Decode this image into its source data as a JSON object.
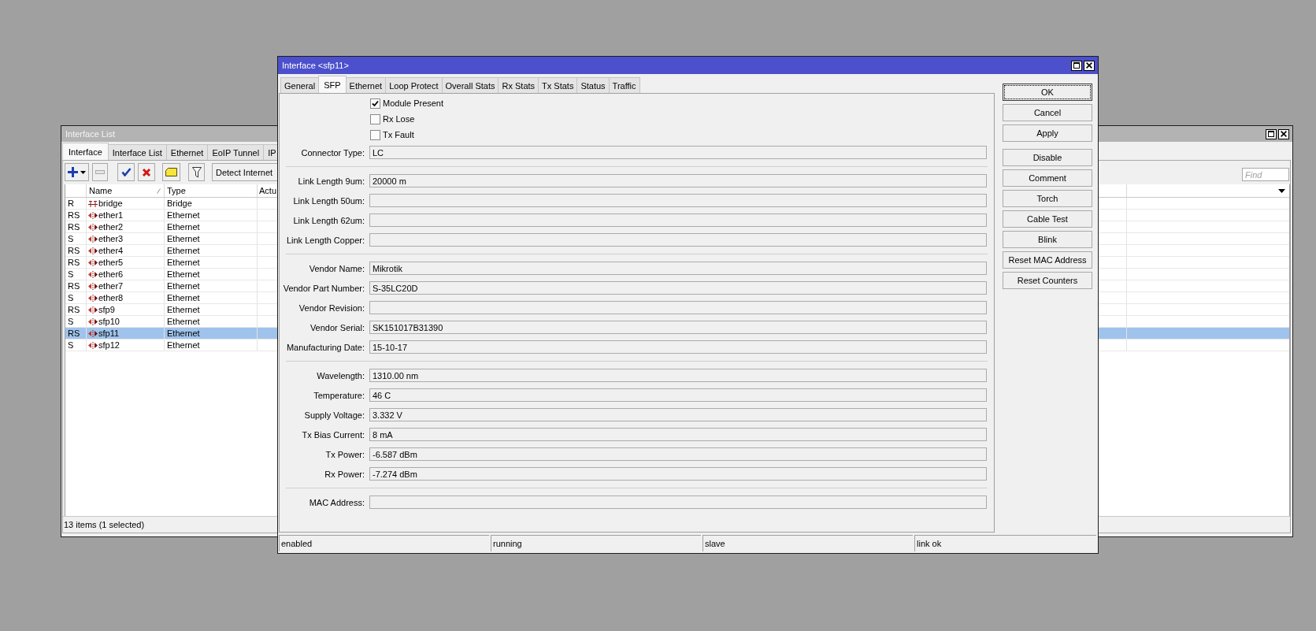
{
  "interface_list_window": {
    "title": "Interface List",
    "active": false,
    "tabs": [
      {
        "label": "Interface",
        "selected": true
      },
      {
        "label": "Interface List",
        "selected": false
      },
      {
        "label": "Ethernet",
        "selected": false
      },
      {
        "label": "EoIP Tunnel",
        "selected": false
      },
      {
        "label": "IP",
        "selected": false
      }
    ],
    "toolbar": [
      {
        "kind": "add",
        "disabled": false
      },
      {
        "kind": "remove",
        "disabled": true
      },
      {
        "kind": "enable",
        "disabled": false
      },
      {
        "kind": "disable",
        "disabled": false
      },
      {
        "kind": "comment",
        "disabled": false
      },
      {
        "kind": "filter",
        "disabled": false
      },
      {
        "kind": "text",
        "label": "Detect Internet",
        "disabled": false
      }
    ],
    "search": {
      "placeholder": "Find"
    },
    "table": {
      "columns": [
        {
          "label": "Name",
          "sorted": true
        },
        {
          "label": "Type",
          "sorted": false
        },
        {
          "label": "Actu",
          "sorted": false
        }
      ],
      "rows": [
        {
          "flags": "R",
          "kind": "bridge",
          "name": "bridge",
          "type": "Bridge",
          "selected": false
        },
        {
          "flags": "RS",
          "kind": "ethernet",
          "name": "ether1",
          "type": "Ethernet",
          "selected": false
        },
        {
          "flags": "RS",
          "kind": "ethernet",
          "name": "ether2",
          "type": "Ethernet",
          "selected": false
        },
        {
          "flags": "S",
          "kind": "ethernet",
          "name": "ether3",
          "type": "Ethernet",
          "selected": false
        },
        {
          "flags": "RS",
          "kind": "ethernet",
          "name": "ether4",
          "type": "Ethernet",
          "selected": false
        },
        {
          "flags": "RS",
          "kind": "ethernet",
          "name": "ether5",
          "type": "Ethernet",
          "selected": false
        },
        {
          "flags": "S",
          "kind": "ethernet",
          "name": "ether6",
          "type": "Ethernet",
          "selected": false
        },
        {
          "flags": "RS",
          "kind": "ethernet",
          "name": "ether7",
          "type": "Ethernet",
          "selected": false
        },
        {
          "flags": "S",
          "kind": "ethernet",
          "name": "ether8",
          "type": "Ethernet",
          "selected": false
        },
        {
          "flags": "RS",
          "kind": "ethernet",
          "name": "sfp9",
          "type": "Ethernet",
          "selected": false
        },
        {
          "flags": "S",
          "kind": "ethernet",
          "name": "sfp10",
          "type": "Ethernet",
          "selected": false
        },
        {
          "flags": "RS",
          "kind": "ethernet",
          "name": "sfp11",
          "type": "Ethernet",
          "selected": true
        },
        {
          "flags": "S",
          "kind": "ethernet",
          "name": "sfp12",
          "type": "Ethernet",
          "selected": false
        }
      ]
    },
    "status_bar": "13 items (1 selected)"
  },
  "interface_dialog": {
    "title": "Interface <sfp11>",
    "active": true,
    "tabs": [
      {
        "label": "General",
        "selected": false
      },
      {
        "label": "SFP",
        "selected": true
      },
      {
        "label": "Ethernet",
        "selected": false
      },
      {
        "label": "Loop Protect",
        "selected": false
      },
      {
        "label": "Overall Stats",
        "selected": false
      },
      {
        "label": "Rx Stats",
        "selected": false
      },
      {
        "label": "Tx Stats",
        "selected": false
      },
      {
        "label": "Status",
        "selected": false
      },
      {
        "label": "Traffic",
        "selected": false
      }
    ],
    "checkboxes": [
      {
        "label": "Module Present",
        "checked": true
      },
      {
        "label": "Rx Lose",
        "checked": false
      },
      {
        "label": "Tx Fault",
        "checked": false
      }
    ],
    "field_groups": [
      [
        {
          "label": "Connector Type:",
          "value": "LC"
        }
      ],
      [
        {
          "label": "Link Length 9um:",
          "value": "20000 m"
        },
        {
          "label": "Link Length 50um:"
        },
        {
          "label": "Link Length 62um:"
        },
        {
          "label": "Link Length Copper:"
        }
      ],
      [
        {
          "label": "Vendor Name:",
          "value": "Mikrotik"
        },
        {
          "label": "Vendor Part Number:",
          "value": "S-35LC20D"
        },
        {
          "label": "Vendor Revision:"
        },
        {
          "label": "Vendor Serial:",
          "value": "SK151017B31390"
        },
        {
          "label": "Manufacturing Date:",
          "value": "15-10-17"
        }
      ],
      [
        {
          "label": "Wavelength:",
          "value": "1310.00 nm"
        },
        {
          "label": "Temperature:",
          "value": "46 C"
        },
        {
          "label": "Supply Voltage:",
          "value": "3.332 V"
        },
        {
          "label": "Tx Bias Current:",
          "value": "8 mA"
        },
        {
          "label": "Tx Power:",
          "value": "-6.587 dBm"
        },
        {
          "label": "Rx Power:",
          "value": "-7.274 dBm"
        }
      ],
      [
        {
          "label": "MAC Address:"
        }
      ]
    ],
    "buttons": [
      [
        {
          "label": "OK",
          "focused": true
        },
        {
          "label": "Cancel",
          "focused": false
        },
        {
          "label": "Apply",
          "focused": false
        }
      ],
      [
        {
          "label": "Disable",
          "focused": false
        },
        {
          "label": "Comment",
          "focused": false
        },
        {
          "label": "Torch",
          "focused": false
        },
        {
          "label": "Cable Test",
          "focused": false
        },
        {
          "label": "Blink",
          "focused": false
        },
        {
          "label": "Reset MAC Address",
          "focused": false
        },
        {
          "label": "Reset Counters",
          "focused": false
        }
      ]
    ],
    "status_bar": [
      "enabled",
      "running",
      "slave",
      "link ok"
    ]
  }
}
